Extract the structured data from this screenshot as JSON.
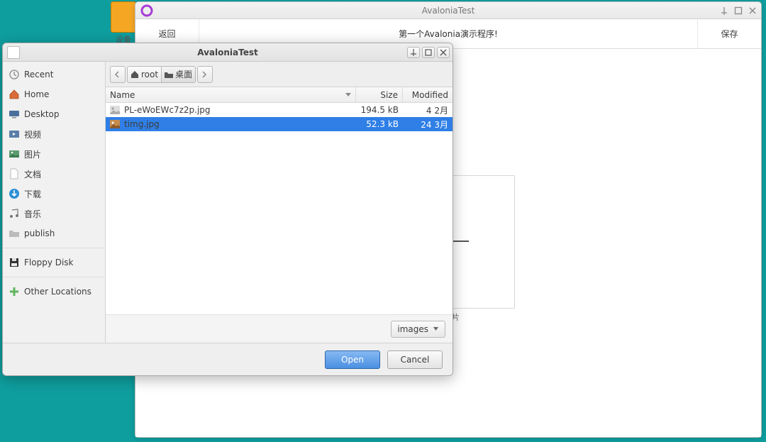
{
  "taskbar_label": "设备",
  "main_window": {
    "title": "AvaloniaTest",
    "back_label": "返回",
    "save_label": "保存",
    "center_text": "第一个Avalonia演示程序!",
    "drop_label": "转图片"
  },
  "file_dialog": {
    "title": "AvaloniaTest",
    "sidebar": [
      {
        "icon": "clock",
        "label": "Recent"
      },
      {
        "icon": "home",
        "label": "Home"
      },
      {
        "icon": "desktop",
        "label": "Desktop"
      },
      {
        "icon": "video",
        "label": "视频"
      },
      {
        "icon": "pictures",
        "label": "图片"
      },
      {
        "icon": "docs",
        "label": "文档"
      },
      {
        "icon": "download",
        "label": "下载"
      },
      {
        "icon": "music",
        "label": "音乐"
      },
      {
        "icon": "folder",
        "label": "publish"
      }
    ],
    "sidebar_bottom": [
      {
        "icon": "floppy",
        "label": "Floppy Disk"
      },
      {
        "icon": "plus",
        "label": "Other Locations"
      }
    ],
    "path": {
      "root_label": "root",
      "desktop_label": "桌面"
    },
    "columns": {
      "name": "Name",
      "size": "Size",
      "modified": "Modified"
    },
    "rows": [
      {
        "name": "PL-eWoEWc7z2p.jpg",
        "size": "194.5 kB",
        "modified": "4 2月",
        "selected": false
      },
      {
        "name": "timg.jpg",
        "size": "52.3 kB",
        "modified": "24 3月",
        "selected": true
      }
    ],
    "filter_label": "images",
    "open_label": "Open",
    "cancel_label": "Cancel"
  }
}
